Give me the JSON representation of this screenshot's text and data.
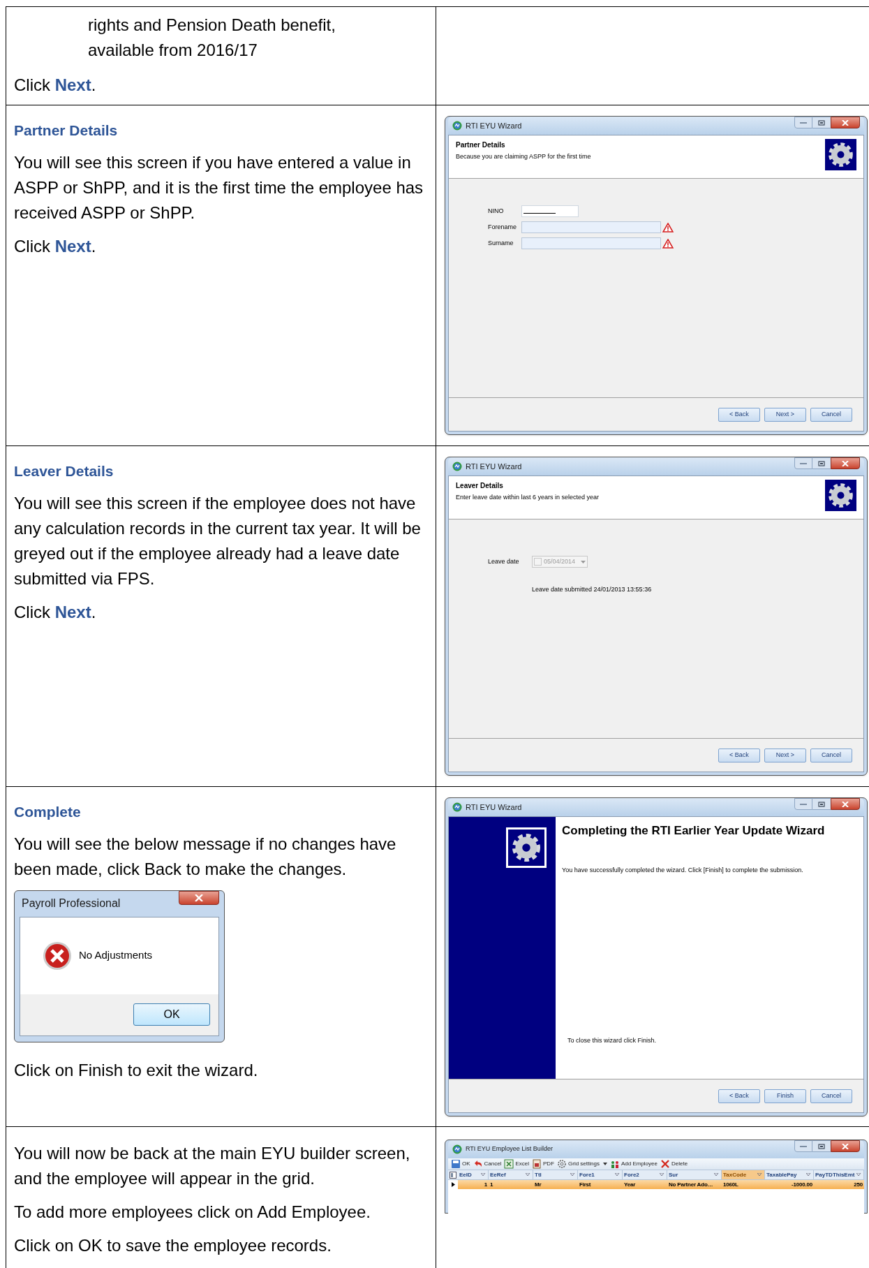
{
  "rows": [
    {
      "left": [
        {
          "kind": "indent",
          "text": "rights and Pension Death benefit, available from 2016/17"
        },
        {
          "kind": "para",
          "text": "Click **Next**."
        }
      ]
    },
    {
      "left": [
        {
          "kind": "heading",
          "text": "Partner Details"
        },
        {
          "kind": "para",
          "text": "You will see this screen if you have entered a value in ASPP or ShPP, and it is the first time the employee has received ASPP or ShPP."
        },
        {
          "kind": "para",
          "text": "Click **Next**."
        }
      ],
      "window": {
        "kind": "form",
        "title": "RTI EYU Wizard",
        "header_title": "Partner Details",
        "header_subtitle": "Because you are claiming ASPP for the first time",
        "fields": [
          {
            "label": "NINO",
            "kind": "mask",
            "warning": false
          },
          {
            "label": "Forename",
            "kind": "text",
            "warning": true
          },
          {
            "label": "Surname",
            "kind": "text",
            "warning": true
          }
        ],
        "buttons": [
          "< Back",
          "Next >",
          "Cancel"
        ]
      }
    },
    {
      "left": [
        {
          "kind": "heading",
          "text": "Leaver Details"
        },
        {
          "kind": "para",
          "text": "You will see this screen if the employee does not have any calculation records in the current tax year. It will be greyed out if the employee already had a leave date submitted via FPS."
        },
        {
          "kind": "para",
          "text": "Click **Next**."
        }
      ],
      "window": {
        "kind": "date",
        "title": "RTI EYU Wizard",
        "header_title": "Leaver Details",
        "header_subtitle": "Enter leave date within last 6 years in selected year",
        "date_field": {
          "label": "Leave date",
          "value": "05/04/2014",
          "checked": false,
          "disabled": true
        },
        "note": "Leave date submitted 24/01/2013 13:55:36",
        "buttons": [
          "< Back",
          "Next >",
          "Cancel"
        ]
      }
    },
    {
      "left": [
        {
          "kind": "heading",
          "text": "Complete"
        },
        {
          "kind": "para",
          "text": "You will see the below message if no changes have been made, click Back to make the changes."
        },
        {
          "kind": "dialog",
          "title": "Payroll Professional",
          "message": "No Adjustments",
          "button": "OK"
        },
        {
          "kind": "para",
          "text": "Click on Finish to exit the wizard."
        }
      ],
      "window": {
        "kind": "complete",
        "title": "RTI EYU Wizard",
        "heading": "Completing the RTI Earlier Year Update Wizard",
        "message": "You have successfully completed the wizard. Click [Finish] to complete the submission.",
        "footer_note": "To close this wizard click Finish.",
        "buttons": [
          "< Back",
          "Finish",
          "Cancel"
        ]
      }
    },
    {
      "left": [
        {
          "kind": "para",
          "text": "You will now be back at the main EYU builder screen, and the employee will appear in the grid."
        },
        {
          "kind": "para",
          "text": "To add more employees click on Add Employee."
        },
        {
          "kind": "para",
          "text": "Click on OK to save the employee records."
        }
      ],
      "window": {
        "kind": "grid",
        "title": "RTI EYU Employee List Builder",
        "toolbar": [
          {
            "label": "OK",
            "kind": "save",
            "dropdown": false
          },
          {
            "label": "Cancel",
            "kind": "undo",
            "dropdown": false
          },
          {
            "label": "Excel",
            "kind": "excel",
            "dropdown": false
          },
          {
            "label": "PDF",
            "kind": "pdf",
            "dropdown": false
          },
          {
            "label": "Grid settings",
            "kind": "gear",
            "dropdown": true
          },
          {
            "label": "Add Employee",
            "kind": "people",
            "dropdown": false
          },
          {
            "label": "Delete",
            "kind": "delete",
            "dropdown": false
          }
        ],
        "columns": [
          {
            "label": "EeID",
            "selected": false
          },
          {
            "label": "EeRef",
            "selected": false
          },
          {
            "label": "Ttl",
            "selected": false
          },
          {
            "label": "Fore1",
            "selected": false
          },
          {
            "label": "Fore2",
            "selected": false
          },
          {
            "label": "Sur",
            "selected": false
          },
          {
            "label": "TaxCode",
            "selected": true
          },
          {
            "label": "TaxablePay",
            "selected": false
          },
          {
            "label": "PayTDThisEmt",
            "selected": false
          }
        ],
        "rows": [
          {
            "selected": true,
            "cells": [
              "1",
              "1",
              "Mr",
              "First",
              "Year",
              "No Partner Ado…",
              "1060L",
              "-1000.00",
              "250"
            ]
          }
        ]
      }
    }
  ]
}
